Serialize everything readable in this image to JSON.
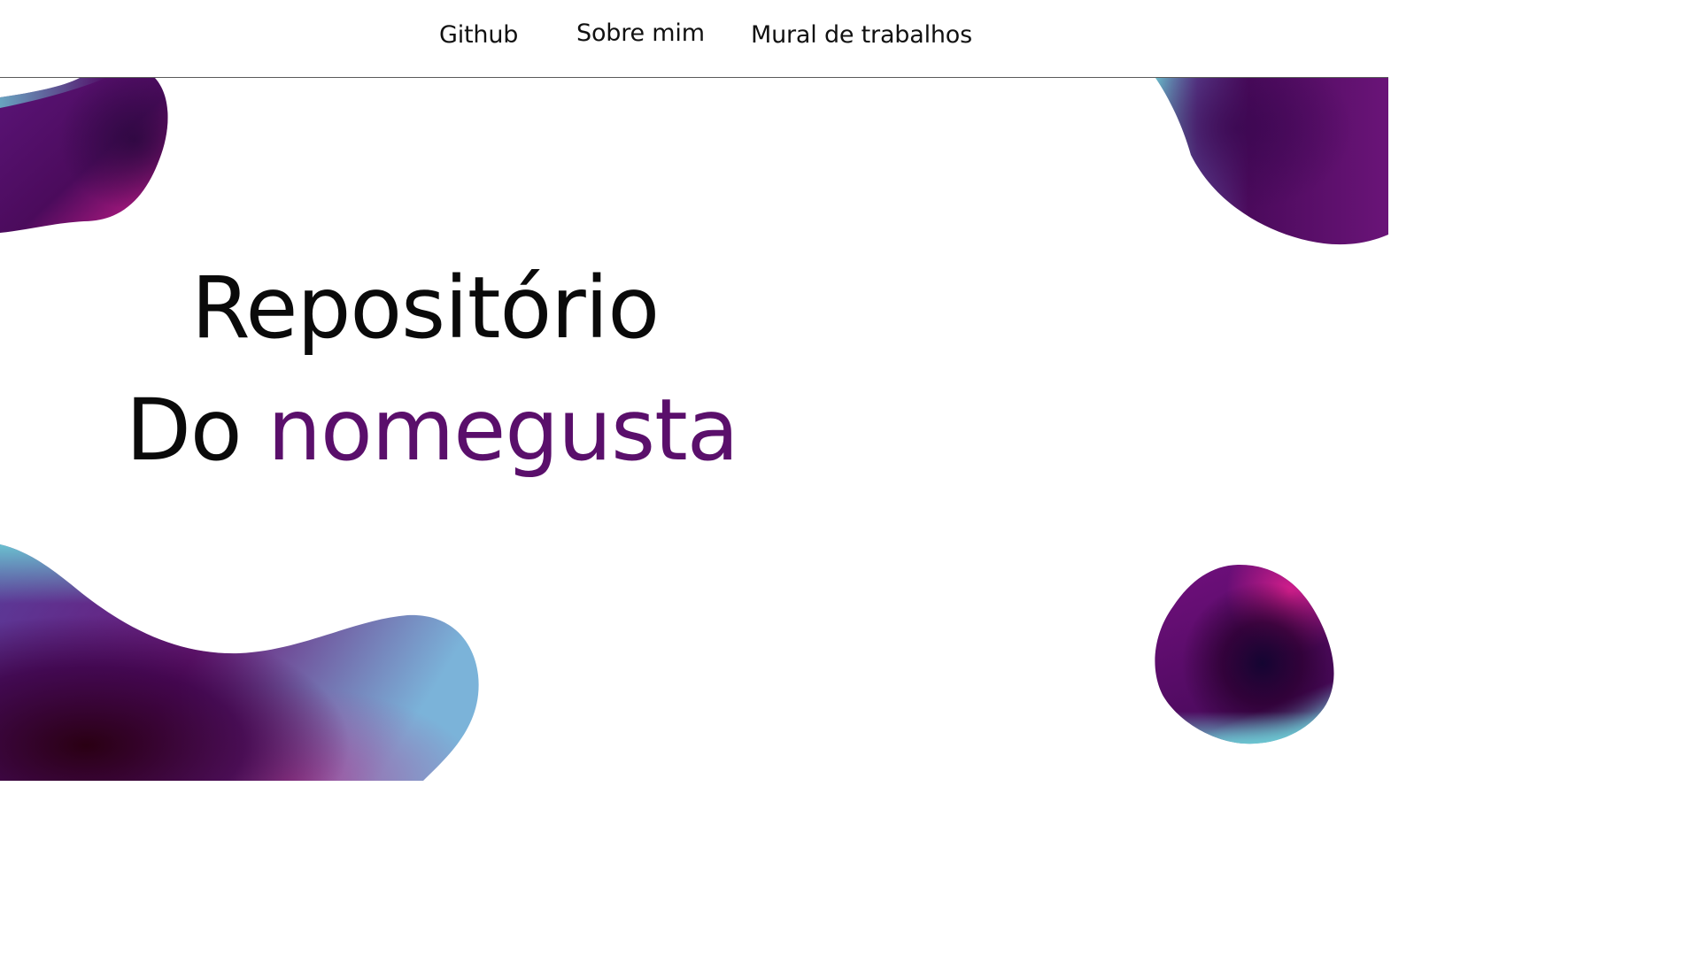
{
  "nav": {
    "items": [
      {
        "label": "Github"
      },
      {
        "label": "Sobre mim"
      },
      {
        "label": "Mural de trabalhos"
      }
    ]
  },
  "hero": {
    "line1": "Repositório",
    "line2_prefix": "Do",
    "line2_highlight": "nomegusta"
  },
  "colors": {
    "accent": "#5a0f6b",
    "blob_deep_purple": "#4a0a5e",
    "blob_magenta": "#d6208f",
    "blob_cyan": "#6cc7d2",
    "blob_dark": "#2a0013"
  }
}
